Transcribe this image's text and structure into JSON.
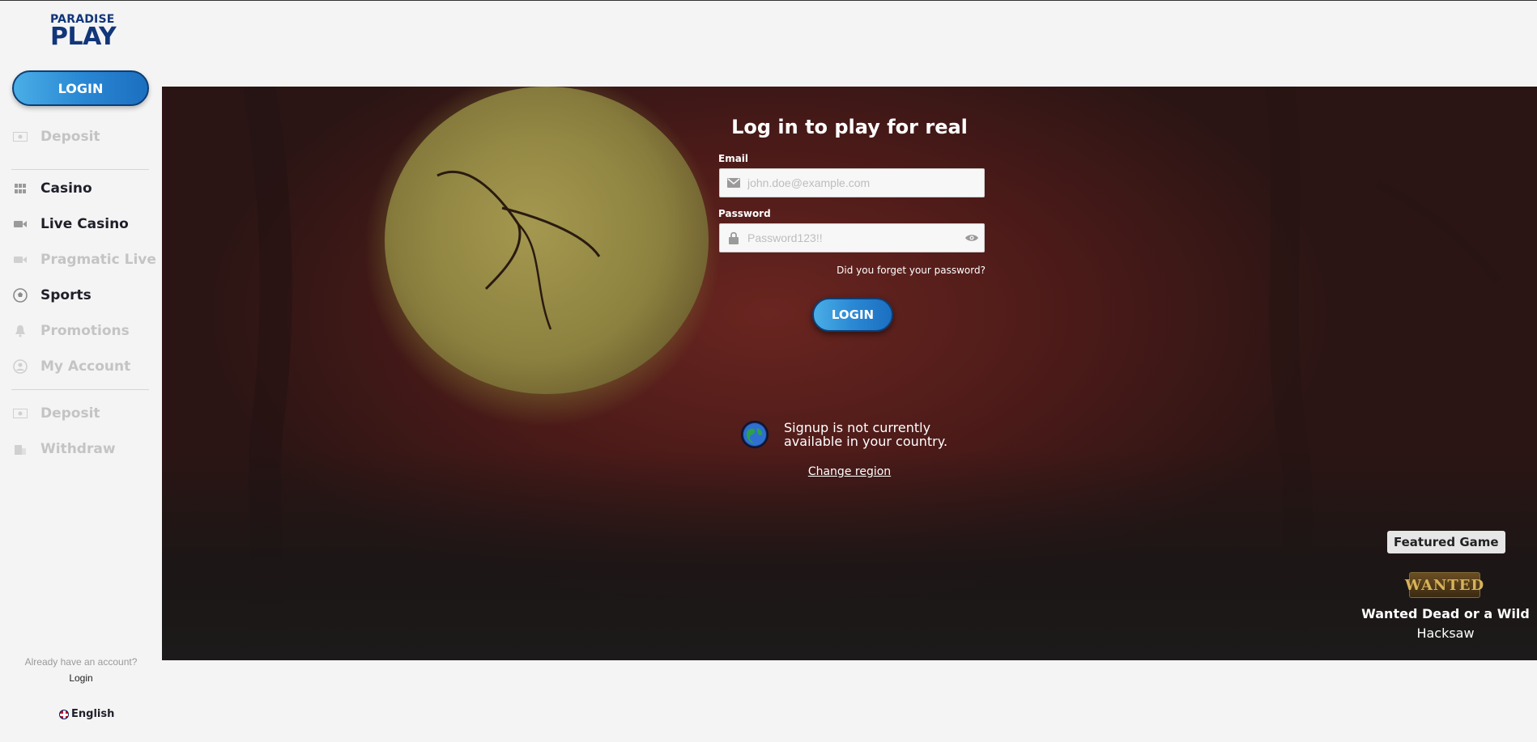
{
  "brand": {
    "line1": "PARADISE",
    "line2": "PLAY"
  },
  "sidebar": {
    "login_label": "LOGIN",
    "items": [
      {
        "label": "Deposit",
        "icon": "money-icon",
        "state": "disabled"
      },
      {
        "label": "Casino",
        "icon": "grid-icon",
        "state": "active"
      },
      {
        "label": "Live Casino",
        "icon": "camera-icon",
        "state": "active"
      },
      {
        "label": "Pragmatic Live",
        "icon": "camera-icon",
        "state": "disabled"
      },
      {
        "label": "Sports",
        "icon": "soccer-ball-icon",
        "state": "active"
      },
      {
        "label": "Promotions",
        "icon": "bell-icon",
        "state": "disabled"
      },
      {
        "label": "My Account",
        "icon": "user-circle-icon",
        "state": "disabled"
      },
      {
        "label": "Deposit",
        "icon": "money-icon",
        "state": "disabled"
      },
      {
        "label": "Withdraw",
        "icon": "bank-icon",
        "state": "disabled"
      }
    ],
    "already_text": "Already have an account?",
    "login_link": "Login",
    "language": "English"
  },
  "login_form": {
    "title": "Log in to play for real",
    "email_label": "Email",
    "email_placeholder": "john.doe@example.com",
    "password_label": "Password",
    "password_placeholder": "Password123!!",
    "forgot": "Did you forget your password?",
    "submit": "LOGIN"
  },
  "region": {
    "message": "Signup is not currently available in your country.",
    "change_link": "Change region"
  },
  "featured": {
    "badge": "Featured Game",
    "thumb_text": "WANTED",
    "game_name": "Wanted Dead or a Wild",
    "provider": "Hacksaw"
  }
}
